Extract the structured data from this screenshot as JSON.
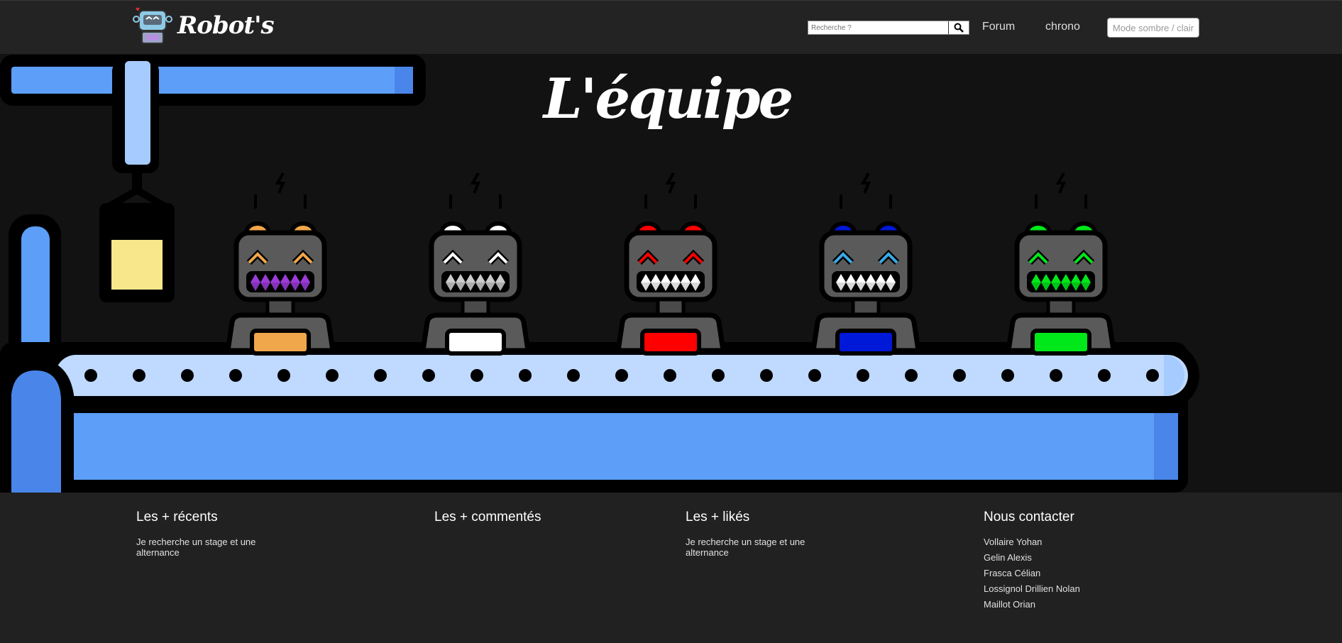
{
  "header": {
    "logo_text": "Robot's",
    "search_placeholder": "Recherche ?",
    "nav": {
      "forum": "Forum",
      "chrono": "chrono"
    },
    "mode_toggle": "Mode sombre / clair"
  },
  "hero": {
    "title": "L'équipe",
    "robots": [
      {
        "color": "#f0a64a",
        "eye": "#f0a64a",
        "teeth": "#9b3bd8"
      },
      {
        "color": "#ffffff",
        "eye": "#ffffff",
        "teeth": "#cccccc"
      },
      {
        "color": "#ff0000",
        "eye": "#ff0000",
        "teeth": "#ffffff"
      },
      {
        "color": "#0018d8",
        "eye": "#3aa9e8",
        "teeth": "#ffffff"
      },
      {
        "color": "#00e81a",
        "eye": "#00e81a",
        "teeth": "#00e81a"
      }
    ]
  },
  "footer": {
    "recent": {
      "title": "Les + récents",
      "items": [
        "Je recherche un stage et une alternance"
      ]
    },
    "commented": {
      "title": "Les + commentés"
    },
    "liked": {
      "title": "Les + likés",
      "items": [
        "Je recherche un stage et une alternance"
      ]
    },
    "contact": {
      "title": "Nous contacter",
      "items": [
        "Vollaire Yohan",
        "Gelin Alexis",
        "Frasca Célian",
        "Lossignol Drillien Nolan",
        "Maillot Orian"
      ]
    }
  },
  "colors": {
    "topbar": "#232323",
    "hero_bg": "#121212",
    "belt_light": "#bfd9ff",
    "belt_blue": "#5c9ef8",
    "box_yellow": "#f9e88b"
  }
}
